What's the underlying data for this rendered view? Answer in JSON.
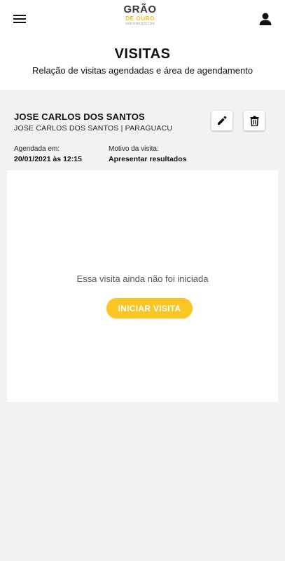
{
  "header": {
    "logo_line1": "GRÃO",
    "logo_line2": "DE OURO",
    "logo_line3": "AGRONEGÓCIOS",
    "title": "VISITAS",
    "subtitle": "Relação de visitas agendadas e área de agendamento"
  },
  "visit": {
    "name": "JOSE CARLOS DOS SANTOS",
    "details": "JOSE CARLOS DOS SANTOS | PARAGUACU",
    "scheduled_label": "Agendada em:",
    "scheduled_value": "20/01/2021 às 12:15",
    "reason_label": "Motivo da visita:",
    "reason_value": "Apresentar resultados"
  },
  "status": {
    "message": "Essa visita ainda não foi iniciada",
    "start_button": "INICIAR VISITA"
  },
  "icons": {
    "menu": "menu-icon",
    "profile": "person-icon",
    "edit": "pencil-icon",
    "delete": "trash-icon"
  },
  "colors": {
    "accent": "#f9c623",
    "logo_gold": "#f5c518",
    "background": "#f2f2f2"
  }
}
